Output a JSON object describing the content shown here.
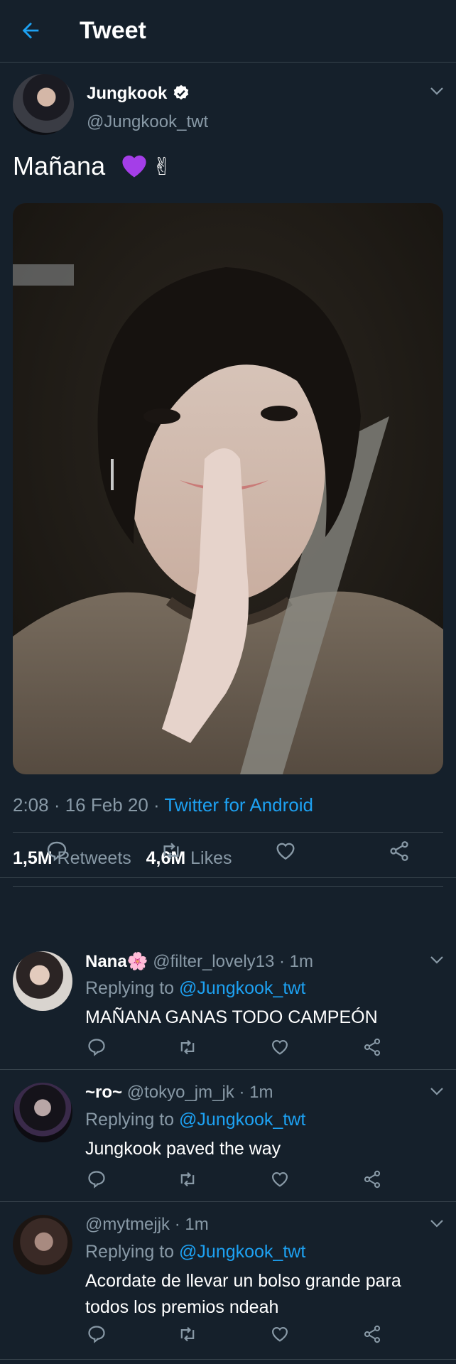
{
  "header": {
    "title": "Tweet",
    "back_icon": "arrow-left-icon"
  },
  "colors": {
    "background": "#15202b",
    "accent": "#1da1f2",
    "muted": "#8899a6",
    "divider": "#38444d"
  },
  "tweet": {
    "author_name": "Jungkook",
    "handle": "@Jungkook_twt",
    "text": "Mañana",
    "emoji_peace": "✌",
    "time": "2:08 · 16 Feb 20 · ",
    "source": "Twitter for Android",
    "retweets_count": "1,5M",
    "retweets_label": "Retweets",
    "likes_count": "4,6M",
    "likes_label": "Likes"
  },
  "replies": [
    {
      "name": "Nana",
      "name_emoji": "🌸",
      "handle_time": "@filter_lovely13 · 1m",
      "replying_label": "Replying to ",
      "replying_to": "@Jungkook_twt",
      "text": "MAÑANA GANAS TODO CAMPEÓN"
    },
    {
      "name": "~ro~",
      "name_emoji": "",
      "handle_time": "@tokyo_jm_jk · 1m",
      "replying_label": "Replying to ",
      "replying_to": "@Jungkook_twt",
      "text": "Jungkook paved the way"
    },
    {
      "name": "",
      "name_emoji": "",
      "handle_time": "@mytmejjk · 1m",
      "replying_label": "Replying to ",
      "replying_to": "@Jungkook_twt",
      "text": "Acordate de llevar un bolso grande para todos los premios ndeah"
    }
  ]
}
